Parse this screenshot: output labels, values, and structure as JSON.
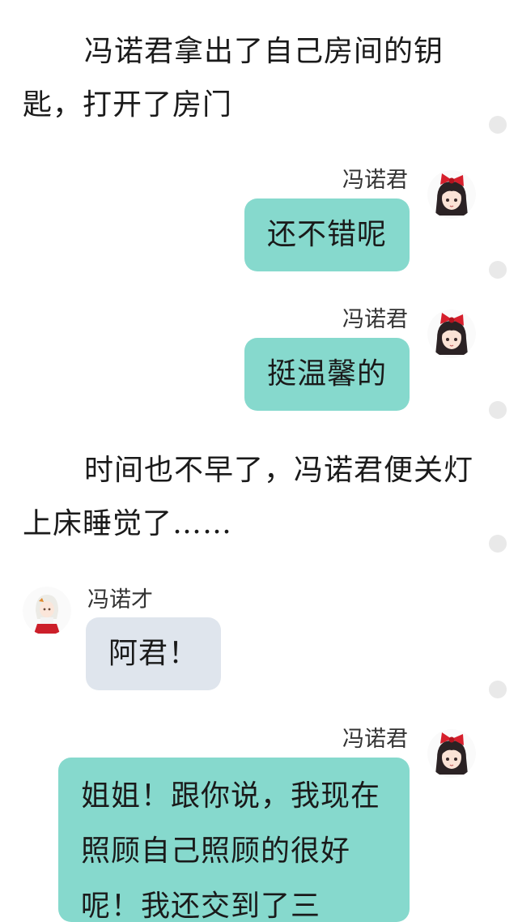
{
  "story": {
    "narration_1": "冯诺君拿出了自己房间的钥匙，打开了房门",
    "message_1": {
      "sender": "冯诺君",
      "text": "还不错呢",
      "avatar": "girl-red-bow-avatar"
    },
    "message_2": {
      "sender": "冯诺君",
      "text": "挺温馨的",
      "avatar": "girl-red-bow-avatar"
    },
    "narration_2": "时间也不早了，冯诺君便关灯上床睡觉了……",
    "message_3": {
      "sender": "冯诺才",
      "text": "阿君！",
      "avatar": "white-hair-girl-avatar"
    },
    "message_4": {
      "sender": "冯诺君",
      "text": "姐姐！跟你说，我现在照顾自己照顾的很好呢！我还交到了三",
      "avatar": "girl-red-bow-avatar"
    }
  },
  "colors": {
    "bubble_self": "#86d9cd",
    "bubble_other": "#dfe5ed",
    "scroll_dot": "#e9e9e9",
    "text": "#1a1a1a"
  }
}
